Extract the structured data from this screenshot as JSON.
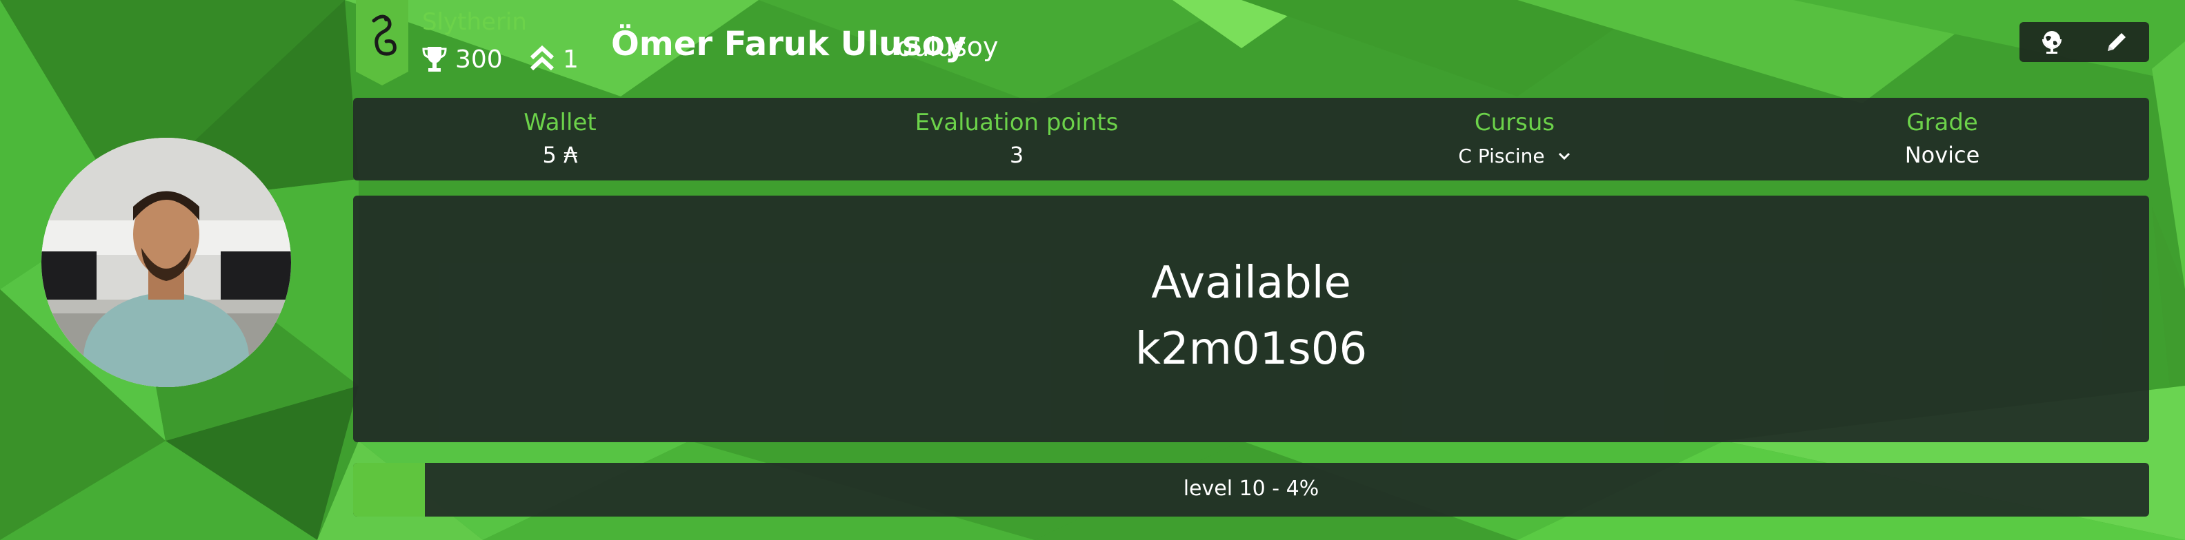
{
  "coalition": {
    "name": "Slytherin",
    "color": "#6cd24a",
    "score": "300",
    "rank": "1"
  },
  "user": {
    "full_name": "Ömer Faruk Ulusoy",
    "login": "oulusoy"
  },
  "actions": [
    "globe-icon",
    "pencil-icon"
  ],
  "stats": {
    "wallet_label": "Wallet",
    "wallet_value": "5 ₳",
    "eval_label": "Evaluation points",
    "eval_value": "3",
    "cursus_label": "Cursus",
    "cursus_value": "C Piscine",
    "grade_label": "Grade",
    "grade_value": "Novice"
  },
  "location": {
    "status": "Available",
    "host": "k2m01s06"
  },
  "level": {
    "text": "level 10 - 4%",
    "percent": 4
  }
}
